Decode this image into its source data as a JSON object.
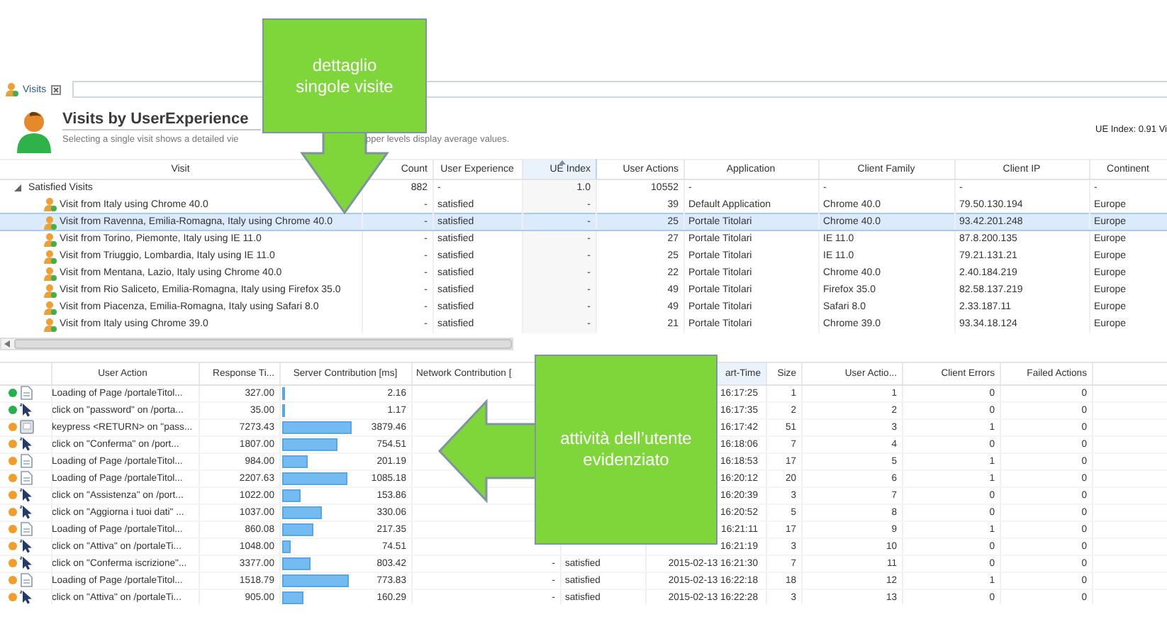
{
  "tab": {
    "label": "Visits",
    "selected": true
  },
  "header": {
    "title": "Visits by UserExperience",
    "subtitle_parts": [
      "Selecting a single visit shows a detailed vie",
      "pper levels display average values."
    ],
    "ue_index": "UE Index: 0.91 Vi"
  },
  "visits_table": {
    "columns": [
      {
        "label": "Visit",
        "sorted": false
      },
      {
        "label": "Count",
        "sorted": false
      },
      {
        "label": "User Experience",
        "sorted": false
      },
      {
        "label": "UE Index",
        "sorted": true
      },
      {
        "label": "User Actions",
        "sorted": false
      },
      {
        "label": "Application",
        "sorted": false
      },
      {
        "label": "Client Family",
        "sorted": false
      },
      {
        "label": "Client IP",
        "sorted": false
      },
      {
        "label": "Continent",
        "sorted": false
      }
    ],
    "groups": [
      {
        "cells": [
          "Satisfied Visits",
          "882",
          "-",
          "1.0",
          "10552",
          "-",
          "-",
          "-",
          "-"
        ],
        "expanded": true,
        "selected": false,
        "children": [
          {
            "cells": [
              "Visit from Italy using Chrome 40.0",
              "-",
              "satisfied",
              "-",
              "39",
              "Default Application",
              "Chrome 40.0",
              "79.50.130.194",
              "Europe"
            ],
            "selected": false
          },
          {
            "cells": [
              "Visit from Ravenna, Emilia-Romagna, Italy using Chrome 40.0",
              "-",
              "satisfied",
              "-",
              "25",
              "Portale Titolari",
              "Chrome 40.0",
              "93.42.201.248",
              "Europe"
            ],
            "selected": true
          },
          {
            "cells": [
              "Visit from Torino, Piemonte, Italy using IE 11.0",
              "-",
              "satisfied",
              "-",
              "27",
              "Portale Titolari",
              "IE 11.0",
              "87.8.200.135",
              "Europe"
            ],
            "selected": false
          },
          {
            "cells": [
              "Visit from Triuggio, Lombardia, Italy using IE 11.0",
              "-",
              "satisfied",
              "-",
              "25",
              "Portale Titolari",
              "IE 11.0",
              "79.21.131.21",
              "Europe"
            ],
            "selected": false
          },
          {
            "cells": [
              "Visit from Mentana, Lazio, Italy using Chrome 40.0",
              "-",
              "satisfied",
              "-",
              "22",
              "Portale Titolari",
              "Chrome 40.0",
              "2.40.184.219",
              "Europe"
            ],
            "selected": false
          },
          {
            "cells": [
              "Visit from Rio Saliceto, Emilia-Romagna, Italy using Firefox 35.0",
              "-",
              "satisfied",
              "-",
              "49",
              "Portale Titolari",
              "Firefox 35.0",
              "82.58.137.219",
              "Europe"
            ],
            "selected": false
          },
          {
            "cells": [
              "Visit from Piacenza, Emilia-Romagna, Italy using Safari 8.0",
              "-",
              "satisfied",
              "-",
              "49",
              "Portale Titolari",
              "Safari 8.0",
              "2.33.187.11",
              "Europe"
            ],
            "selected": false
          },
          {
            "cells": [
              "Visit from Italy using Chrome 39.0",
              "-",
              "satisfied",
              "-",
              "21",
              "Portale Titolari",
              "Chrome 39.0",
              "93.34.18.124",
              "Europe"
            ],
            "selected": false
          }
        ]
      }
    ]
  },
  "actions_table": {
    "columns": [
      "User Action",
      "Response Ti...",
      "Server Contribution [ms]",
      "Network Contribution [",
      "art-Time",
      "Size",
      "User Actio...",
      "Client Errors",
      "Failed Actions"
    ],
    "rows": [
      {
        "color": "#22b14c",
        "kind": "page",
        "level": 0,
        "action": "Loading of Page /portaleTitol...",
        "response": "327.00",
        "server": "2.16",
        "start_time": "16:17:25",
        "size": "1",
        "action_index": "1",
        "client_errors": "0",
        "failed_actions": "0"
      },
      {
        "color": "#22b14c",
        "kind": "click",
        "level": 0.03,
        "action": "click on \"password\" on /porta...",
        "response": "35.00",
        "server": "1.17",
        "start_time": "16:17:35",
        "size": "2",
        "action_index": "2",
        "client_errors": "0",
        "failed_actions": "0"
      },
      {
        "color": "#f39c2a",
        "kind": "keypress",
        "level": 0.53,
        "action": "keypress <RETURN> on \"pass...",
        "response": "7273.43",
        "server": "3879.46",
        "start_time": "16:17:42",
        "size": "51",
        "action_index": "3",
        "client_errors": "1",
        "failed_actions": "0"
      },
      {
        "color": "#f39c2a",
        "kind": "click",
        "level": 0.42,
        "action": "click on \"Conferma\" on /port...",
        "response": "1807.00",
        "server": "754.51",
        "start_time": "16:18:06",
        "size": "7",
        "action_index": "4",
        "client_errors": "0",
        "failed_actions": "0"
      },
      {
        "color": "#f39c2a",
        "kind": "page",
        "level": 0.2,
        "action": "Loading of Page /portaleTitol...",
        "response": "984.00",
        "server": "201.19",
        "start_time": "16:18:53",
        "size": "17",
        "action_index": "5",
        "client_errors": "1",
        "failed_actions": "0"
      },
      {
        "color": "#f39c2a",
        "kind": "page",
        "level": 0.5,
        "action": "Loading of Page /portaleTitol...",
        "response": "2207.63",
        "server": "1085.18",
        "start_time": "16:20:12",
        "size": "20",
        "action_index": "6",
        "client_errors": "1",
        "failed_actions": "0"
      },
      {
        "color": "#f39c2a",
        "kind": "click",
        "level": 0.15,
        "action": "click on \"Assistenza\" on /port...",
        "response": "1022.00",
        "server": "153.86",
        "start_time": "16:20:39",
        "size": "3",
        "action_index": "7",
        "client_errors": "0",
        "failed_actions": "0"
      },
      {
        "color": "#f39c2a",
        "kind": "click",
        "level": 0.31,
        "action": "click on \"Aggiorna i tuoi dati\" ...",
        "response": "1037.00",
        "server": "330.06",
        "start_time": "16:20:52",
        "size": "5",
        "action_index": "8",
        "client_errors": "0",
        "failed_actions": "0"
      },
      {
        "color": "#f39c2a",
        "kind": "page",
        "level": 0.24,
        "action": "Loading of Page /portaleTitol...",
        "response": "860.08",
        "server": "217.35",
        "start_time": "16:21:11",
        "size": "17",
        "action_index": "9",
        "client_errors": "1",
        "failed_actions": "0"
      },
      {
        "color": "#f39c2a",
        "kind": "click",
        "level": 0.07,
        "action": "click on \"Attiva\" on /portaleTi...",
        "response": "1048.00",
        "server": "74.51",
        "start_time": "16:21:19",
        "size": "3",
        "action_index": "10",
        "client_errors": "0",
        "failed_actions": "0"
      },
      {
        "color": "#f39c2a",
        "kind": "click",
        "level": 0.22,
        "action": "click on \"Conferma iscrizione\"...",
        "response": "3377.00",
        "server": "803.42",
        "network": "-",
        "experience": "satisfied",
        "start_time": "2015-02-13 16:21:30",
        "size": "7",
        "action_index": "11",
        "client_errors": "0",
        "failed_actions": "0"
      },
      {
        "color": "#f39c2a",
        "kind": "page",
        "level": 0.51,
        "action": "Loading of Page /portaleTitol...",
        "response": "1518.79",
        "server": "773.83",
        "network": "-",
        "experience": "satisfied",
        "start_time": "2015-02-13 16:22:18",
        "size": "18",
        "action_index": "12",
        "client_errors": "1",
        "failed_actions": "0"
      },
      {
        "color": "#f39c2a",
        "kind": "click",
        "level": 0.17,
        "action": "click on \"Attiva\" on /portaleTi...",
        "response": "905.00",
        "server": "160.29",
        "network": "-",
        "experience": "satisfied",
        "start_time": "2015-02-13 16:22:28",
        "size": "3",
        "action_index": "13",
        "client_errors": "0",
        "failed_actions": "0"
      }
    ]
  },
  "callouts": [
    {
      "kind": "down",
      "text": "dettaglio singole visite"
    },
    {
      "kind": "left",
      "text": "attività dell’utente evidenziato"
    }
  ]
}
